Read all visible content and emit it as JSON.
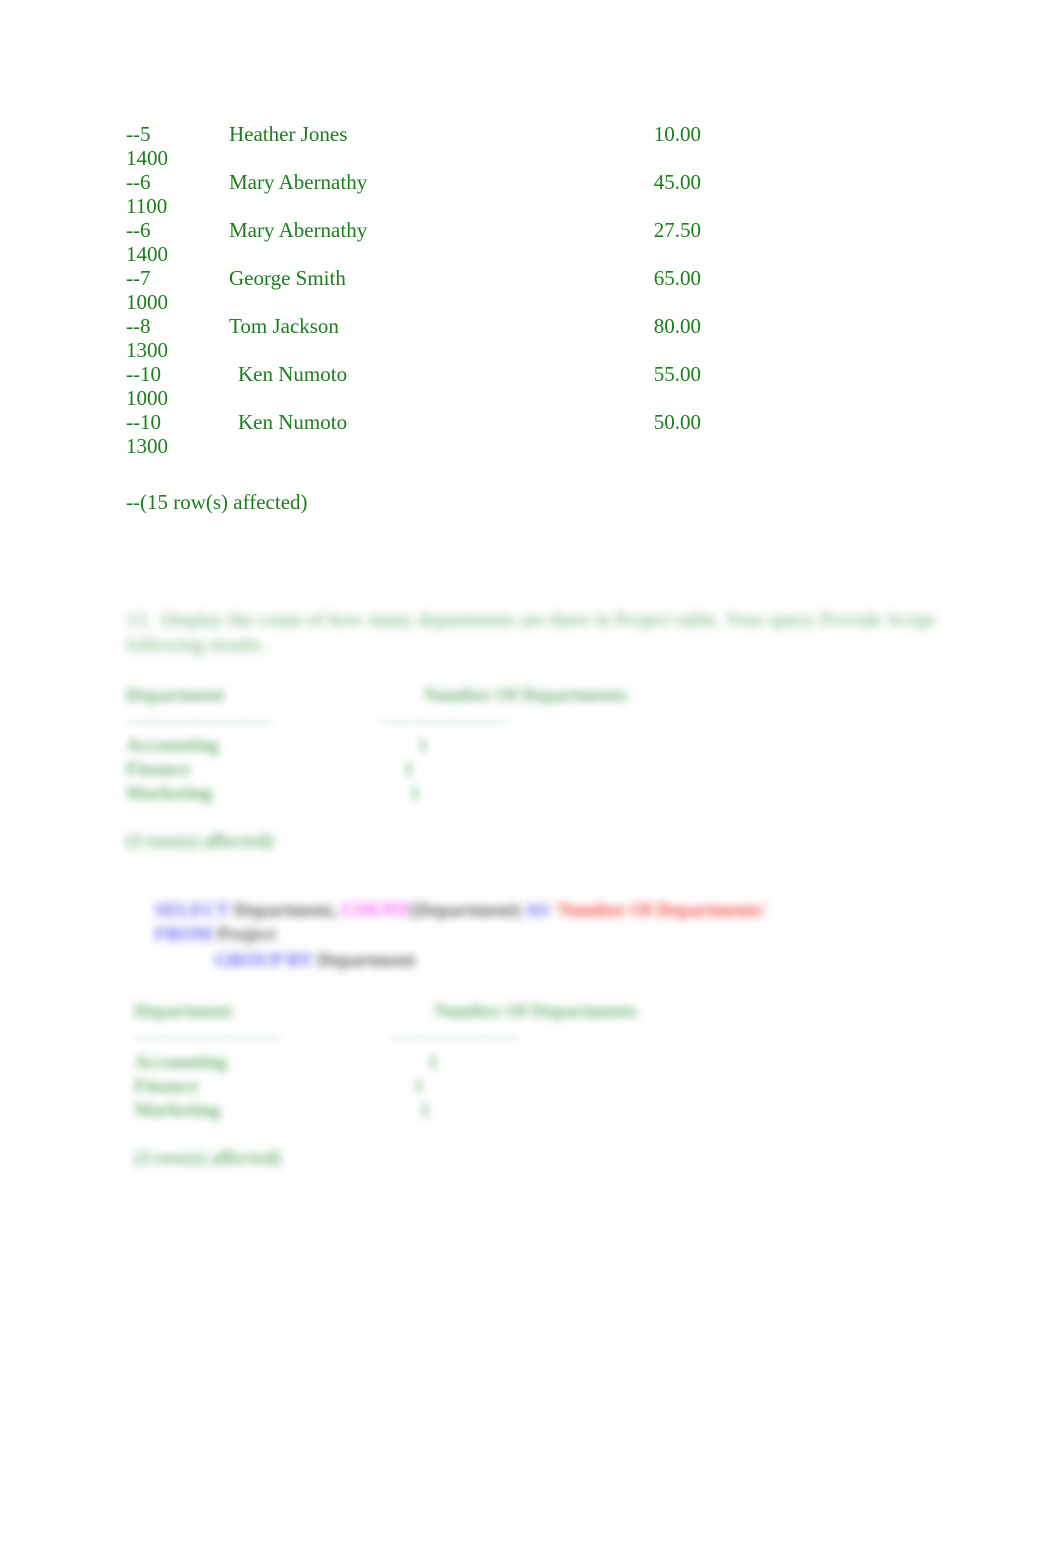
{
  "document": {
    "page_background": "#ffffff",
    "result_text_color": "#1a7f1a",
    "blur_text_color": "#2f8f34"
  },
  "query_results": {
    "rows": [
      {
        "id": "--5",
        "name": "Heather Jones",
        "amount": "10.00",
        "dept": "1400",
        "indent": false
      },
      {
        "id": "--6",
        "name": "Mary Abernathy",
        "amount": "45.00",
        "dept": "1100",
        "indent": false
      },
      {
        "id": "--6",
        "name": "Mary Abernathy",
        "amount": "27.50",
        "dept": "1400",
        "indent": false
      },
      {
        "id": "--7",
        "name": "George Smith",
        "amount": "65.00",
        "dept": "1000",
        "indent": false
      },
      {
        "id": "--8",
        "name": "Tom Jackson",
        "amount": "80.00",
        "dept": "1300",
        "indent": false
      },
      {
        "id": "--10",
        "name": "Ken Numoto",
        "amount": "55.00",
        "dept": "1000",
        "indent": true
      },
      {
        "id": "--10",
        "name": "Ken Numoto",
        "amount": "50.00",
        "dept": "1300",
        "indent": true
      }
    ],
    "affected": "--(15 row(s) affected)"
  },
  "question": {
    "number": "13.",
    "text": "Display the count of how many departments are there in Project table. Your query  Provide Script following results."
  },
  "result_block_1": {
    "header_left": "Department",
    "header_right": "Number Of Departments",
    "separator_left": "-------------------------",
    "separator_right": "----------------------",
    "rows": [
      {
        "department": "Accounting",
        "count": "1"
      },
      {
        "department": "Finance",
        "count": "1"
      },
      {
        "department": "Marketing",
        "count": "1"
      }
    ],
    "affected": "(3 row(s) affected)"
  },
  "sql_snippet": {
    "line1": [
      {
        "text": "SELECT ",
        "token": "keyword"
      },
      {
        "text": "Department, ",
        "token": "identifier"
      },
      {
        "text": "COUNT",
        "token": "function"
      },
      {
        "text": "(Department) ",
        "token": "identifier"
      },
      {
        "text": "AS ",
        "token": "keyword"
      },
      {
        "text": "'Number Of Departments'",
        "token": "string"
      }
    ],
    "line1b": [
      {
        "text": "FROM ",
        "token": "keyword"
      },
      {
        "text": "Project",
        "token": "identifier"
      }
    ],
    "line2": [
      {
        "text": "GROUP ",
        "token": "keyword"
      },
      {
        "text": "BY ",
        "token": "keyword"
      },
      {
        "text": "Department",
        "token": "identifier"
      }
    ],
    "colors": {
      "keyword": "#5b5bf0",
      "identifier": "#555555",
      "function": "#f33df3",
      "string": "#f03c3c"
    }
  },
  "result_block_2": {
    "header_left": "Department",
    "header_right": "Number Of Departments",
    "separator_left": "-------------------------",
    "separator_right": "----------------------",
    "rows": [
      {
        "department": "Accounting",
        "count": "1"
      },
      {
        "department": "Finance",
        "count": "1"
      },
      {
        "department": "Marketing",
        "count": "1"
      }
    ],
    "affected": "(3 row(s) affected)"
  }
}
